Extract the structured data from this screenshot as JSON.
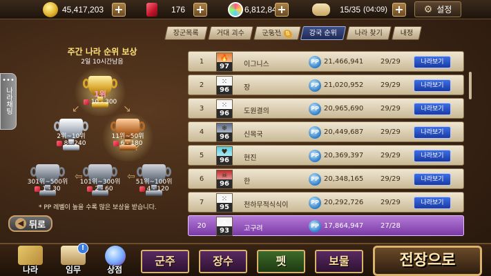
{
  "topbar": {
    "gold": "45,417,203",
    "ruby": "176",
    "candy": "6,812,847",
    "stamina": "15/35",
    "stamina_timer": "(04:09)",
    "settings_label": "설정"
  },
  "tabs": [
    {
      "label": "장군목록"
    },
    {
      "label": "거대 괴수"
    },
    {
      "label": "군웅전"
    },
    {
      "label": "강국 순위"
    },
    {
      "label": "나라 찾기"
    },
    {
      "label": "내정"
    }
  ],
  "tab_badge": "B",
  "chat": {
    "dots": "•••",
    "label": "나라채팅"
  },
  "reward": {
    "title": "주간 나라 순위 보상",
    "time_left": "2일 10시간남음",
    "tiers": [
      {
        "rank": "1위",
        "reward": "10 - 300"
      },
      {
        "rank": "2위~10위",
        "reward": "8 - 240"
      },
      {
        "rank": "11위~50위",
        "reward": "6 - 180"
      },
      {
        "rank": "301위~500위",
        "reward": "1 - 30"
      },
      {
        "rank": "101위~300위",
        "reward": "2 - 60"
      },
      {
        "rank": "51위~100위",
        "reward": "4 - 120"
      }
    ],
    "note": "* PP 레벨이 높을 수록 많은 보상을 받습니다."
  },
  "back_label": "뒤로",
  "pp_label": "PP",
  "view_label": "나라보기",
  "rankings": [
    {
      "rank": "1",
      "level": "97",
      "symbol": "🔥",
      "flag_color": "#e47a2a",
      "name": "이그니스",
      "pp": "21,466,941",
      "attendance": "29/29"
    },
    {
      "rank": "2",
      "level": "96",
      "symbol": "⁙",
      "flag_color": "#f4f4f4",
      "name": "장",
      "pp": "21,020,952",
      "attendance": "29/29"
    },
    {
      "rank": "3",
      "level": "96",
      "symbol": "⁙",
      "flag_color": "#f4f4f4",
      "name": "도원결의",
      "pp": "20,965,690",
      "attendance": "29/29"
    },
    {
      "rank": "4",
      "level": "96",
      "symbol": "❄",
      "flag_color": "#5a6a8a",
      "name": "신목국",
      "pp": "20,449,687",
      "attendance": "29/29"
    },
    {
      "rank": "5",
      "level": "96",
      "symbol": "♥",
      "flag_color": "#5ad0e4",
      "name": "현진",
      "pp": "20,369,397",
      "attendance": "29/29"
    },
    {
      "rank": "6",
      "level": "96",
      "symbol": "☠",
      "flag_color": "#c02a2a",
      "name": "한",
      "pp": "20,348,165",
      "attendance": "29/29"
    },
    {
      "rank": "7",
      "level": "95",
      "symbol": "⁙",
      "flag_color": "#f4f4f4",
      "name": "천하무적식식이",
      "pp": "20,292,726",
      "attendance": "29/29"
    }
  ],
  "my_nation": {
    "rank": "20",
    "level": "93",
    "symbol": "✕",
    "flag_color": "#f4f4f4",
    "name": "고구려",
    "pp": "17,864,947",
    "attendance": "27/28"
  },
  "bottom_nav": {
    "nation": "나라",
    "quest": "임무",
    "quest_badge": "!",
    "shop": "상점",
    "lord": "군주",
    "general": "장수",
    "pet": "펫",
    "treasure": "보물",
    "battle": "전장으로"
  },
  "colors": {
    "accent_purple": "#7a3aa6",
    "button_blue": "#1a3aa2",
    "gold": "#d9b46a"
  }
}
